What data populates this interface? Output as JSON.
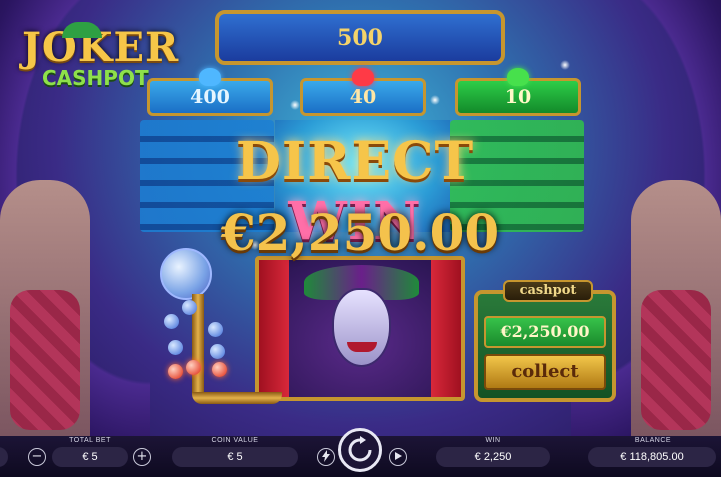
{
  "game": {
    "logo_line1": "JOKER",
    "logo_line2": "CASHPOT"
  },
  "jackpots": {
    "top": "500",
    "blue": "400",
    "red": "40",
    "green": "10"
  },
  "win_banner": {
    "word1": "DIRECT",
    "word2": "WIN",
    "amount": "€2,250.00"
  },
  "cashpot": {
    "title": "cashpot",
    "value": "€2,250.00",
    "collect_label": "collect"
  },
  "bottom_bar": {
    "total_bet_label": "TOTAL BET",
    "total_bet_value": "€ 5",
    "minus_label": "−",
    "plus_label": "+",
    "coin_value_label": "COIN VALUE",
    "coin_value": "€ 5",
    "win_label": "WIN",
    "win_value": "€ 2,250",
    "balance_label": "BALANCE",
    "balance_value": "€ 118,805.00",
    "turbo_icon": "lightning-icon",
    "spin_icon": "refresh-icon",
    "autoplay_icon": "play-icon"
  },
  "colors": {
    "gold": "#c6962f",
    "blue_tier": "#1b6fc6",
    "green_tier": "#138a2a",
    "bar_bg": "#1c1436"
  }
}
